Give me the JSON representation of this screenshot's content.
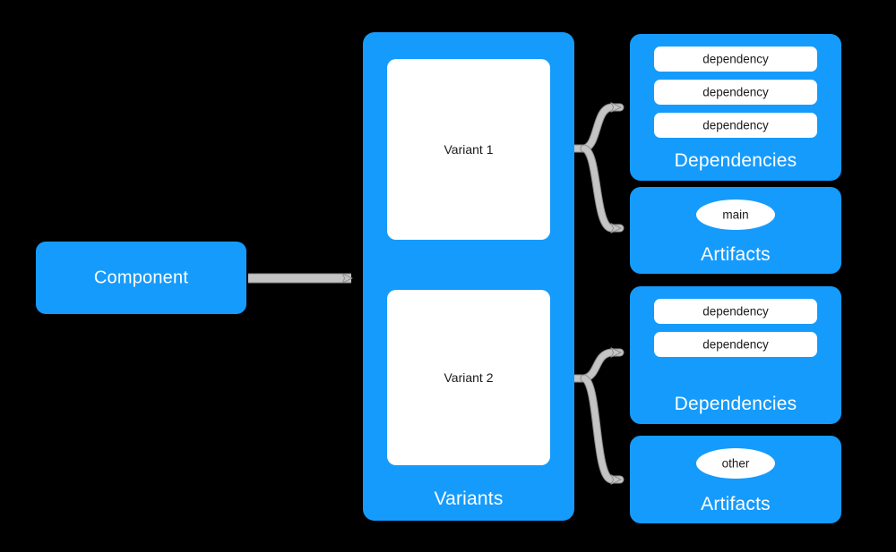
{
  "diagram": {
    "title": "Component / Variants / Dependencies / Artifacts",
    "background_color": "#000000",
    "node_color": "#159BFC",
    "node_text_color": "#ffffff",
    "inner_box_color": "#ffffff",
    "inner_text_color": "#1a1a1a",
    "connector_color": "#c4c4c4",
    "connector_outline_color": "#8f8f8f"
  },
  "component": {
    "label": "Component"
  },
  "variants_group": {
    "footer_label": "Variants",
    "variants": [
      {
        "label": "Variant 1"
      },
      {
        "label": "Variant 2"
      }
    ]
  },
  "dependencies_groups": [
    {
      "footer_label": "Dependencies",
      "items": [
        {
          "label": "dependency"
        },
        {
          "label": "dependency"
        },
        {
          "label": "dependency"
        }
      ]
    },
    {
      "footer_label": "Dependencies",
      "items": [
        {
          "label": "dependency"
        },
        {
          "label": "dependency"
        }
      ]
    }
  ],
  "artifacts_groups": [
    {
      "footer_label": "Artifacts",
      "items": [
        {
          "label": "main"
        }
      ]
    },
    {
      "footer_label": "Artifacts",
      "items": [
        {
          "label": "other"
        }
      ]
    }
  ],
  "connectors": [
    {
      "name": "component-to-variants",
      "from": "Component",
      "to": "Variants",
      "style": "straight-arrow"
    },
    {
      "name": "variant1-to-dependencies1",
      "from": "Variant 1",
      "to": "Dependencies",
      "style": "forked-curve-arrow"
    },
    {
      "name": "variant1-to-artifacts1",
      "from": "Variant 1",
      "to": "Artifacts",
      "style": "forked-curve-arrow"
    },
    {
      "name": "variant2-to-dependencies2",
      "from": "Variant 2",
      "to": "Dependencies",
      "style": "forked-curve-arrow"
    },
    {
      "name": "variant2-to-artifacts2",
      "from": "Variant 2",
      "to": "Artifacts",
      "style": "forked-curve-arrow"
    }
  ]
}
